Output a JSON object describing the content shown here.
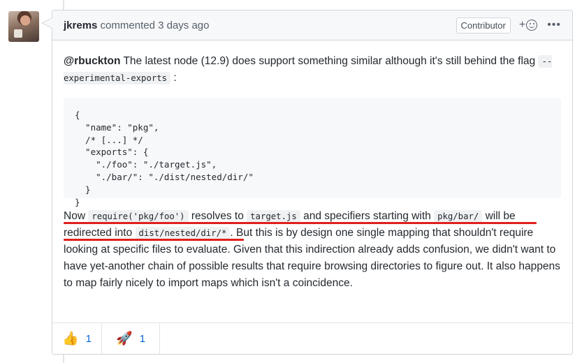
{
  "comment": {
    "author": "jkrems",
    "action": "commented",
    "time": "3 days ago",
    "role_badge": "Contributor",
    "add_reaction_label": "+",
    "more_label": "•••",
    "intro": {
      "mention": "@rbuckton",
      "text": " The latest node (12.9) does support something similar although it's still behind the flag ",
      "flag": "-⁠-experimental-exports",
      "end": " :"
    },
    "code_block": "{\n  \"name\": \"pkg\",\n  /* [...] */\n  \"exports\": {\n    \"./foo\": \"./target.js\",\n    \"./bar/\": \"./dist/nested/dir/\"\n  }\n}",
    "para2": {
      "t1": "Now ",
      "c1": "require('pkg/foo')",
      "t2": " resolves to ",
      "c2": "target.js",
      "t3": " and specifiers starting with ",
      "c3": "pkg/bar/",
      "t4": " will be redirected into ",
      "c4": "dist/nested/dir/*",
      "t5": ". But this is by design one single mapping that shouldn't require looking at specific files to evaluate. Given that this indirection already adds confusion, we didn't want to have yet-another chain of possible results that require browsing directories to figure out. It also happens to map fairly nicely to import maps which isn't a coincidence."
    },
    "reactions": [
      {
        "emoji": "👍",
        "icon": "thumbs-up-icon",
        "count": "1"
      },
      {
        "emoji": "🚀",
        "icon": "rocket-icon",
        "count": "1"
      }
    ]
  },
  "colors": {
    "annotation_underline": "#e0201c",
    "link": "#0366d6"
  }
}
